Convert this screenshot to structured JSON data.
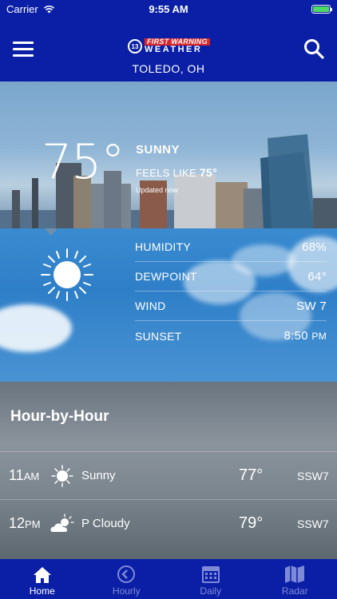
{
  "status_bar": {
    "carrier": "Carrier",
    "time": "9:55 AM",
    "battery_level": 1.0
  },
  "header": {
    "logo_top": "FIRST WARNING",
    "logo_bottom": "WEATHER",
    "logo_badge": "13",
    "location": "TOLEDO, OH",
    "icons": [
      "menu-icon",
      "search-icon"
    ]
  },
  "current": {
    "temperature": "75°",
    "condition": "SUNNY",
    "feels_like_label": "FEELS LIKE",
    "feels_like_value": "75°",
    "updated": "Updated now",
    "icon": "sun-icon"
  },
  "details": [
    {
      "label": "HUMIDITY",
      "value": "68%"
    },
    {
      "label": "DEWPOINT",
      "value": "64°"
    },
    {
      "label": "WIND",
      "value": "SW 7"
    },
    {
      "label": "SUNSET",
      "value": "8:50",
      "suffix": "PM"
    }
  ],
  "hourly": {
    "title": "Hour-by-Hour",
    "rows": [
      {
        "hour": "11",
        "ampm": "AM",
        "icon": "sun-icon",
        "condition": "Sunny",
        "temp": "77°",
        "wind": "SSW7"
      },
      {
        "hour": "12",
        "ampm": "PM",
        "icon": "partly-cloudy-icon",
        "condition": "P Cloudy",
        "temp": "79°",
        "wind": "SSW7"
      }
    ]
  },
  "tabs": [
    {
      "label": "Home",
      "icon": "home-icon",
      "active": true
    },
    {
      "label": "Hourly",
      "icon": "clock-icon",
      "active": false
    },
    {
      "label": "Daily",
      "icon": "calendar-icon",
      "active": false
    },
    {
      "label": "Radar",
      "icon": "map-icon",
      "active": false
    }
  ],
  "colors": {
    "brand_blue": "#0a1fa6",
    "tab_inactive": "#7f8ad6",
    "logo_red": "#d8262b",
    "battery_green": "#4cd964"
  }
}
